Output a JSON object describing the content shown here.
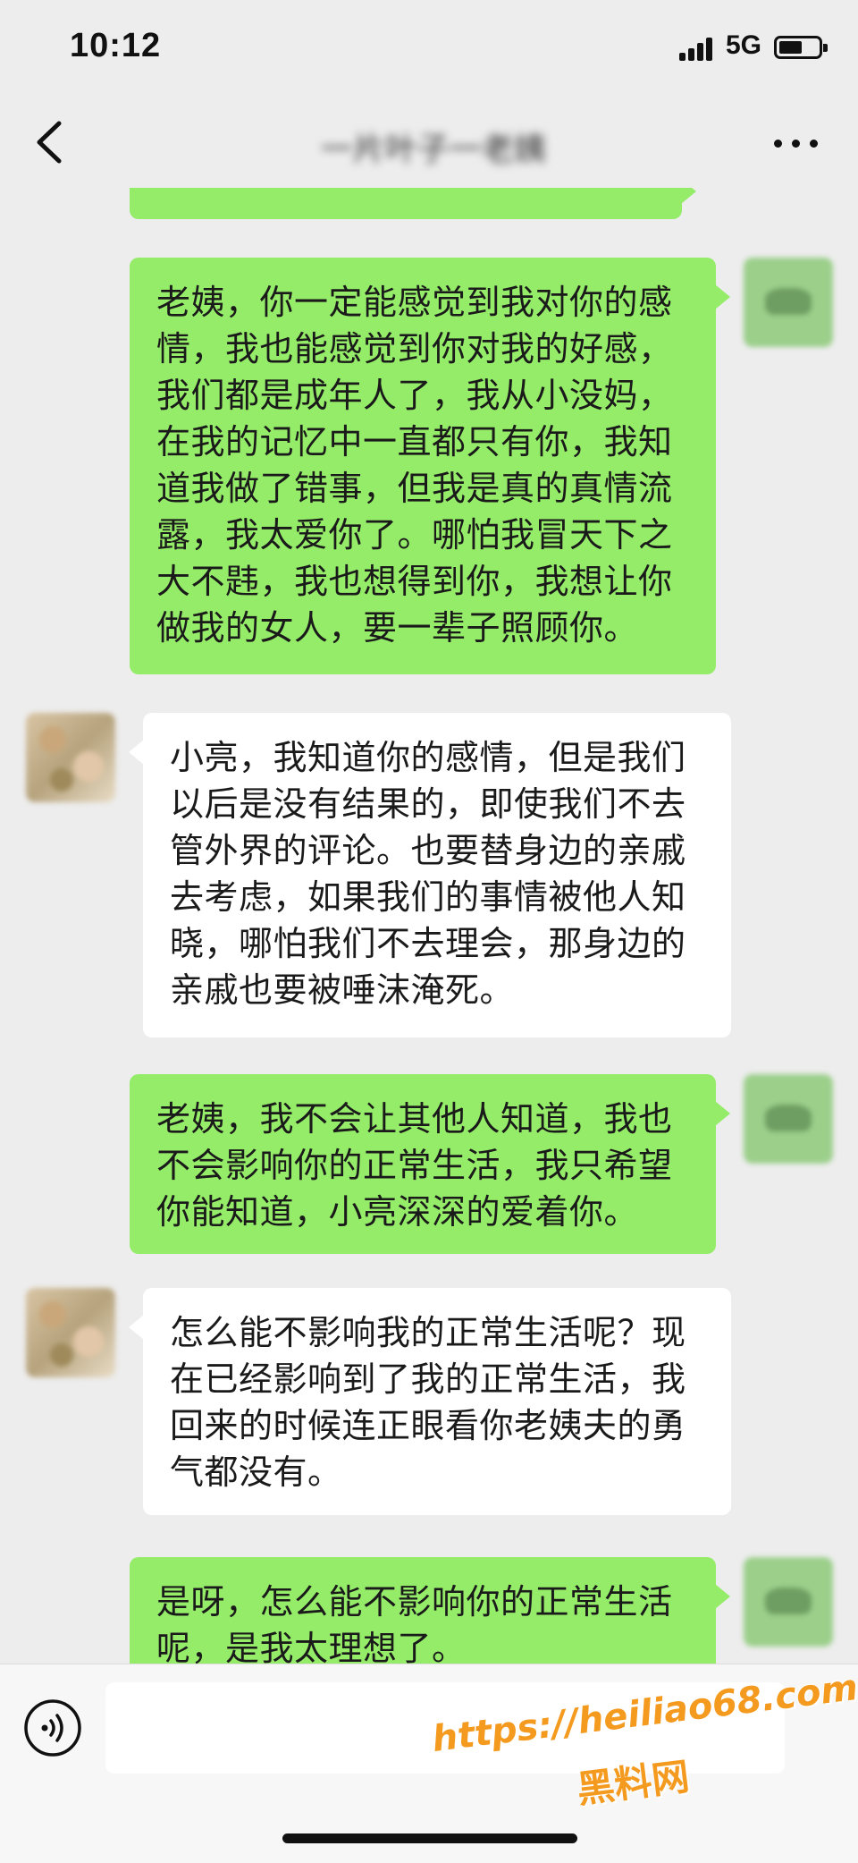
{
  "status_bar": {
    "time": "10:12",
    "network": "5G",
    "battery_level": 0.6
  },
  "header": {
    "title": "一片叶子一老姨"
  },
  "messages": [
    {
      "from": "self",
      "text": ""
    },
    {
      "from": "self",
      "text": "老姨，你一定能感觉到我对你的感情，我也能感觉到你对我的好感，我们都是成年人了，我从小没妈，在我的记忆中一直都只有你，我知道我做了错事，但我是真的真情流露，我太爱你了。哪怕我冒天下之大不韪，我也想得到你，我想让你做我的女人，要一辈子照顾你。"
    },
    {
      "from": "other",
      "text": "小亮，我知道你的感情，但是我们以后是没有结果的，即使我们不去管外界的评论。也要替身边的亲戚去考虑，如果我们的事情被他人知晓，哪怕我们不去理会，那身边的亲戚也要被唾沫淹死。"
    },
    {
      "from": "self",
      "text": "老姨，我不会让其他人知道，我也不会影响你的正常生活，我只希望你能知道，小亮深深的爱着你。"
    },
    {
      "from": "other",
      "text": "怎么能不影响我的正常生活呢？现在已经影响到了我的正常生活，我回来的时候连正眼看你老姨夫的勇气都没有。"
    },
    {
      "from": "self",
      "text": "是呀，怎么能不影响你的正常生活呢，是我太理想了。"
    }
  ],
  "input": {
    "value": ""
  },
  "watermark": {
    "url": "https://heiliao68.com",
    "name": "黑料网"
  },
  "colors": {
    "background": "#ededed",
    "sent_bubble": "#95ec69",
    "received_bubble": "#ffffff",
    "watermark": "#f49a1e"
  },
  "icons": {
    "back": "chevron-left-icon",
    "more": "more-dots-icon",
    "voice": "voice-icon",
    "signal": "signal-icon",
    "battery": "battery-icon"
  }
}
